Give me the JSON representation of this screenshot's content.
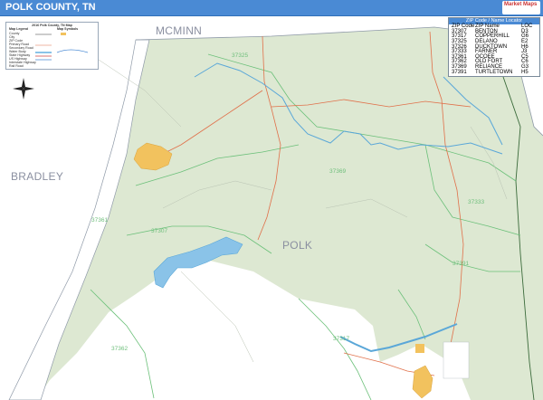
{
  "header": {
    "title": "POLK COUNTY, TN",
    "brand_text": "Market Maps"
  },
  "legend": {
    "title": "2016 Polk County, TN Map",
    "col1": "Map Legend",
    "col2": "Map Symbols",
    "rows": [
      "County",
      "City",
      "ZIP Code",
      "Primary Road",
      "Secondary Road",
      "Water Body",
      "State Highway",
      "US Highway",
      "Interstate Highway",
      "Rail Road"
    ]
  },
  "zip_table": {
    "title": "ZIP Code / Name Locator",
    "headers": [
      "ZIP Code",
      "ZIP Name",
      "LOC"
    ],
    "rows": [
      [
        "37307",
        "BENTON",
        "D3"
      ],
      [
        "37317",
        "COPPERHILL",
        "G6"
      ],
      [
        "37325",
        "DELANO",
        "E2"
      ],
      [
        "37326",
        "DUCKTOWN",
        "H6"
      ],
      [
        "37333",
        "FARNER",
        "J3"
      ],
      [
        "37361",
        "OCOEE",
        "C5"
      ],
      [
        "37362",
        "OLD FORT",
        "C6"
      ],
      [
        "37369",
        "RELIANCE",
        "G3"
      ],
      [
        "37391",
        "TURTLETOWN",
        "H5"
      ]
    ]
  },
  "map_labels": {
    "counties": {
      "mcminn": "MCMINN",
      "bradley": "BRADLEY",
      "polk": "POLK"
    },
    "zips": {
      "z37325": "37325",
      "z37369": "37369",
      "z37333": "37333",
      "z37391": "37391",
      "z37361": "37361",
      "z37307": "37307",
      "z37362": "37362",
      "z37317": "37317"
    }
  },
  "colors": {
    "header": "#4a8ad4",
    "land": "#dde8d2",
    "outside": "#ffffff",
    "water": "#8ac3e8",
    "city": "#f2c25e",
    "roads": "#e0704a",
    "zip_boundary": "#6cc07a"
  },
  "icons": {
    "compass": "compass-rose-icon"
  }
}
